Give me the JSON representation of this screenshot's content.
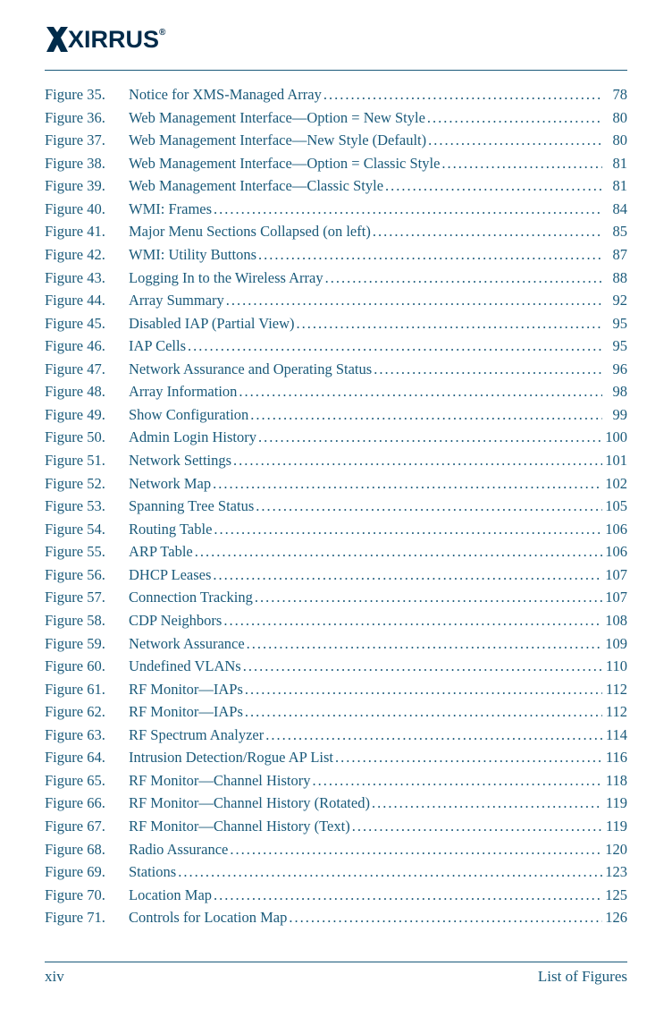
{
  "logo": {
    "text": "XIRRUS",
    "symbol": "®"
  },
  "toc_entries": [
    {
      "num": "Figure 35.",
      "title": "Notice for XMS-Managed Array",
      "page": "78"
    },
    {
      "num": "Figure 36.",
      "title": "Web Management Interface—Option = New Style",
      "page": "80"
    },
    {
      "num": "Figure 37.",
      "title": "Web Management Interface—New Style (Default)",
      "page": "80"
    },
    {
      "num": "Figure 38.",
      "title": "Web Management Interface—Option = Classic Style",
      "page": "81"
    },
    {
      "num": "Figure 39.",
      "title": "Web Management Interface—Classic Style",
      "page": "81"
    },
    {
      "num": "Figure 40.",
      "title": "WMI: Frames",
      "page": "84"
    },
    {
      "num": "Figure 41.",
      "title": "Major Menu Sections Collapsed (on left)",
      "page": "85"
    },
    {
      "num": "Figure 42.",
      "title": "WMI: Utility Buttons",
      "page": "87"
    },
    {
      "num": "Figure 43.",
      "title": "Logging In to the Wireless Array",
      "page": "88"
    },
    {
      "num": "Figure 44.",
      "title": "Array Summary",
      "page": "92"
    },
    {
      "num": "Figure 45.",
      "title": "Disabled IAP (Partial View)",
      "page": "95"
    },
    {
      "num": "Figure 46.",
      "title": "IAP Cells",
      "page": "95"
    },
    {
      "num": "Figure 47.",
      "title": "Network Assurance and Operating Status",
      "page": "96"
    },
    {
      "num": "Figure 48.",
      "title": "Array Information",
      "page": "98"
    },
    {
      "num": "Figure 49.",
      "title": "Show Configuration",
      "page": "99"
    },
    {
      "num": "Figure 50.",
      "title": "Admin Login History",
      "page": "100"
    },
    {
      "num": "Figure 51.",
      "title": "Network Settings",
      "page": "101"
    },
    {
      "num": "Figure 52.",
      "title": "Network Map",
      "page": "102"
    },
    {
      "num": "Figure 53.",
      "title": "Spanning Tree Status",
      "page": "105"
    },
    {
      "num": "Figure 54.",
      "title": "Routing Table",
      "page": "106"
    },
    {
      "num": "Figure 55.",
      "title": "ARP Table",
      "page": "106"
    },
    {
      "num": "Figure 56.",
      "title": "DHCP Leases",
      "page": "107"
    },
    {
      "num": "Figure 57.",
      "title": "Connection Tracking",
      "page": "107"
    },
    {
      "num": "Figure 58.",
      "title": "CDP Neighbors",
      "page": "108"
    },
    {
      "num": "Figure 59.",
      "title": "Network Assurance",
      "page": "109"
    },
    {
      "num": "Figure 60.",
      "title": "Undefined VLANs",
      "page": "110"
    },
    {
      "num": "Figure 61.",
      "title": "RF Monitor—IAPs",
      "page": "112"
    },
    {
      "num": "Figure 62.",
      "title": "RF Monitor—IAPs",
      "page": "112"
    },
    {
      "num": "Figure 63.",
      "title": "RF Spectrum Analyzer",
      "page": "114"
    },
    {
      "num": "Figure 64.",
      "title": "Intrusion Detection/Rogue AP List",
      "page": "116"
    },
    {
      "num": "Figure 65.",
      "title": "RF Monitor—Channel History",
      "page": "118"
    },
    {
      "num": "Figure 66.",
      "title": "RF Monitor—Channel History (Rotated)",
      "page": "119"
    },
    {
      "num": "Figure 67.",
      "title": "RF Monitor—Channel History (Text)",
      "page": "119"
    },
    {
      "num": "Figure 68.",
      "title": "Radio Assurance",
      "page": "120"
    },
    {
      "num": "Figure 69.",
      "title": "Stations",
      "page": "123"
    },
    {
      "num": "Figure 70.",
      "title": "Location Map",
      "page": "125"
    },
    {
      "num": "Figure 71.",
      "title": "Controls for Location Map",
      "page": "126"
    }
  ],
  "footer": {
    "left": "xiv",
    "right": "List of Figures"
  }
}
